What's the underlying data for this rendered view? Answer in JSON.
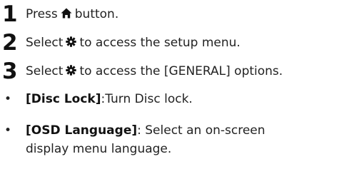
{
  "steps": [
    {
      "number": "1",
      "before_icon": "Press",
      "icon": "home-icon",
      "after_icon": "button."
    },
    {
      "number": "2",
      "before_icon": "Select",
      "icon": "gear-icon",
      "after_icon": "to access the setup menu."
    },
    {
      "number": "3",
      "before_icon": "Select",
      "icon": "gear-icon",
      "after_icon": "to access the [GENERAL] options."
    }
  ],
  "bullets": [
    {
      "marker": "•",
      "term": "[Disc Lock]",
      "description": ":Turn Disc lock."
    },
    {
      "marker": "•",
      "term": "[OSD Language]",
      "description": ": Select an on-screen display menu language."
    }
  ]
}
